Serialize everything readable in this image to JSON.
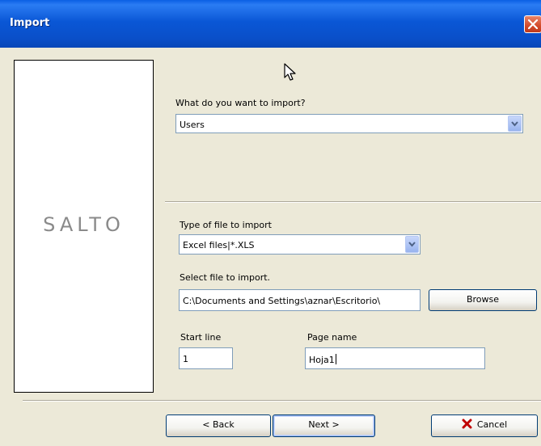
{
  "window": {
    "title": "Import"
  },
  "brand": {
    "logo_text": "SALTO"
  },
  "import": {
    "question_label": "What do you want to import?",
    "selected": "Users"
  },
  "file_type": {
    "label": "Type of file to import",
    "selected": "Excel files|*.XLS"
  },
  "file_select": {
    "label": "Select file to import.",
    "path": "C:\\Documents and Settings\\aznar\\Escritorio\\",
    "browse_label": "Browse"
  },
  "start_line": {
    "label": "Start line",
    "value": "1"
  },
  "page_name": {
    "label": "Page name",
    "value": "Hoja1"
  },
  "footer": {
    "back_label": "< Back",
    "next_label": "Next >",
    "cancel_label": "Cancel"
  },
  "colors": {
    "titlebar": "#0a57d6",
    "face": "#ece9d8",
    "cancel_icon": "#c00000"
  }
}
